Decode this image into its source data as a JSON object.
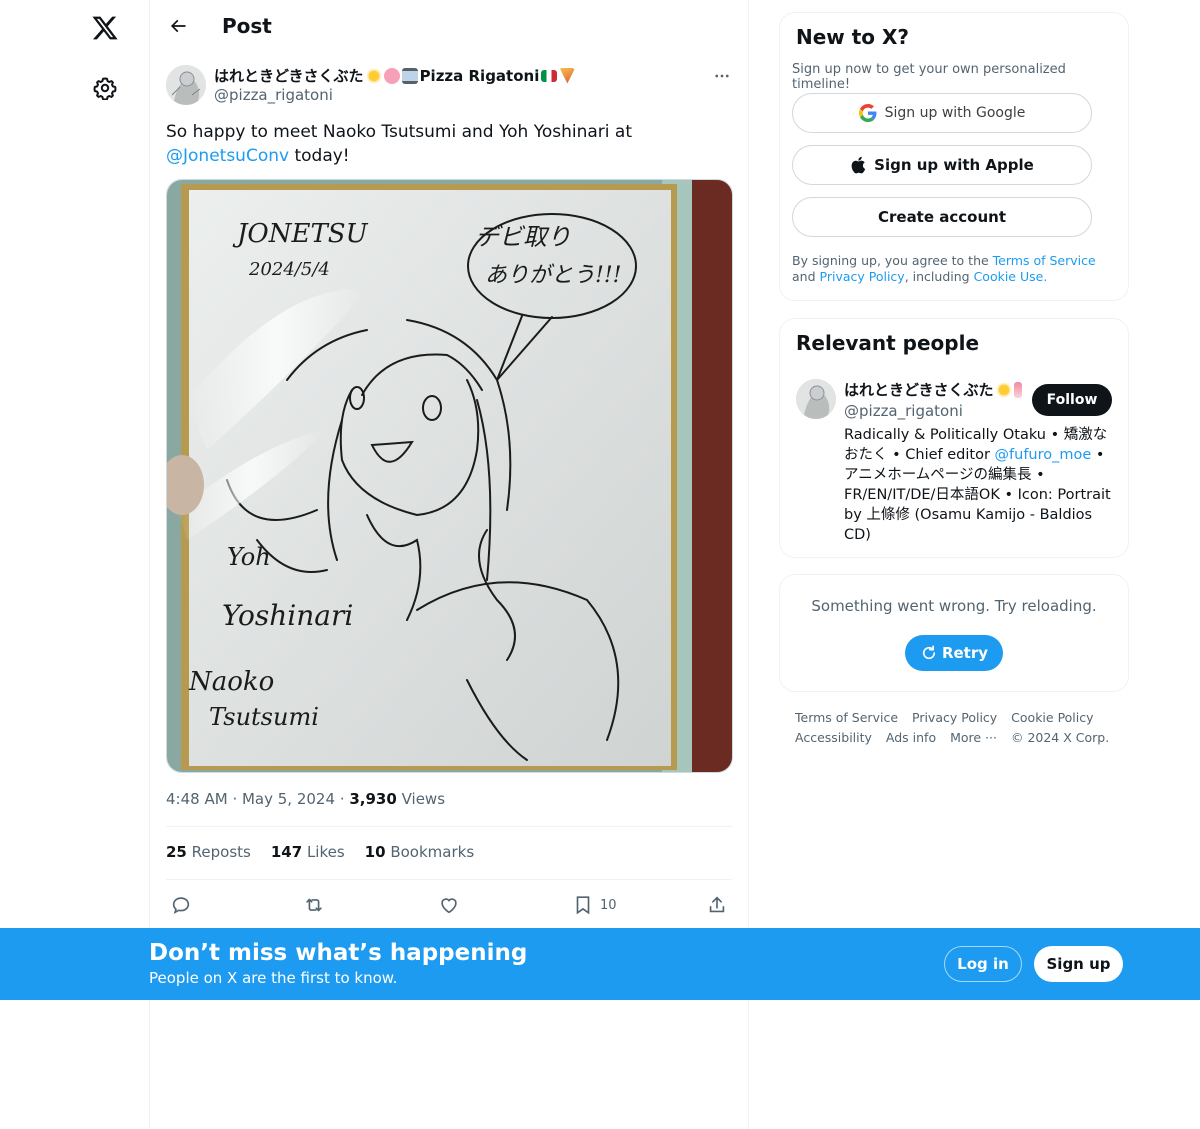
{
  "topbar": {
    "title": "Post"
  },
  "tweet": {
    "author_name": "はれときどきさくぶた",
    "author_suffix": "Pizza Rigatoni",
    "author_handle": "@pizza_rigatoni",
    "text_before": "So happy to meet Naoko Tsutsumi and Yoh Yoshinari at ",
    "mention": "@JonetsuConv",
    "text_after": " today!",
    "time": "4:48 AM",
    "date": "May 5, 2024",
    "views_count": "3,930",
    "views_label": "Views",
    "reposts_count": "25",
    "reposts_label": "Reposts",
    "likes_count": "147",
    "likes_label": "Likes",
    "bookmarks_count": "10",
    "bookmarks_label": "Bookmarks",
    "bookmark_action_count": "10",
    "media_text": {
      "event": "JONETSU",
      "date": "2024/5/4",
      "bubble_line1": "デビ取り",
      "bubble_line2": "ありがとう!!!",
      "sig1_line1": "Yoh",
      "sig1_line2": "Yoshinari",
      "sig2_line1": "Naoko",
      "sig2_line2": "Tsutsumi"
    }
  },
  "signup_card": {
    "title": "New to X?",
    "subtitle": "Sign up now to get your own personalized timeline!",
    "google_label": "Sign up with Google",
    "apple_label": "Sign up with Apple",
    "create_label": "Create account",
    "legal_prefix": "By signing up, you agree to the ",
    "terms_link": "Terms of Service",
    "legal_and": " and",
    "privacy_link": "Privacy Policy",
    "legal_including": ", including ",
    "cookie_link": "Cookie Use."
  },
  "relevant_people": {
    "title": "Relevant people",
    "name": "はれときどきさくぶた",
    "handle": "@pizza_rigatoni",
    "follow_label": "Follow",
    "bio_part1": "Radically & Politically Otaku • 矯激なおたく • Chief editor ",
    "bio_link": "@fufuro_moe",
    "bio_part2": " • アニメホームページの編集長 • FR/EN/IT/DE/日本語OK • Icon: Portrait by 上條修 (Osamu Kamijo - Baldios CD)"
  },
  "error_card": {
    "message": "Something went wrong. Try reloading.",
    "retry_label": "Retry"
  },
  "footer": {
    "links": [
      "Terms of Service",
      "Privacy Policy",
      "Cookie Policy",
      "Accessibility",
      "Ads info",
      "More ···",
      "© 2024 X Corp."
    ]
  },
  "banner": {
    "title": "Don’t miss what’s happening",
    "subtitle": "People on X are the first to know.",
    "login_label": "Log in",
    "signup_label": "Sign up"
  },
  "colors": {
    "accent": "#1d9bf0",
    "text": "#0f1419",
    "muted": "#536471",
    "border": "#eff3f4"
  },
  "icons": [
    "x-logo-icon",
    "gear-icon",
    "back-arrow-icon",
    "more-icon",
    "reply-icon",
    "repost-icon",
    "like-icon",
    "bookmark-icon",
    "share-icon",
    "google-icon",
    "apple-icon",
    "retry-icon"
  ]
}
